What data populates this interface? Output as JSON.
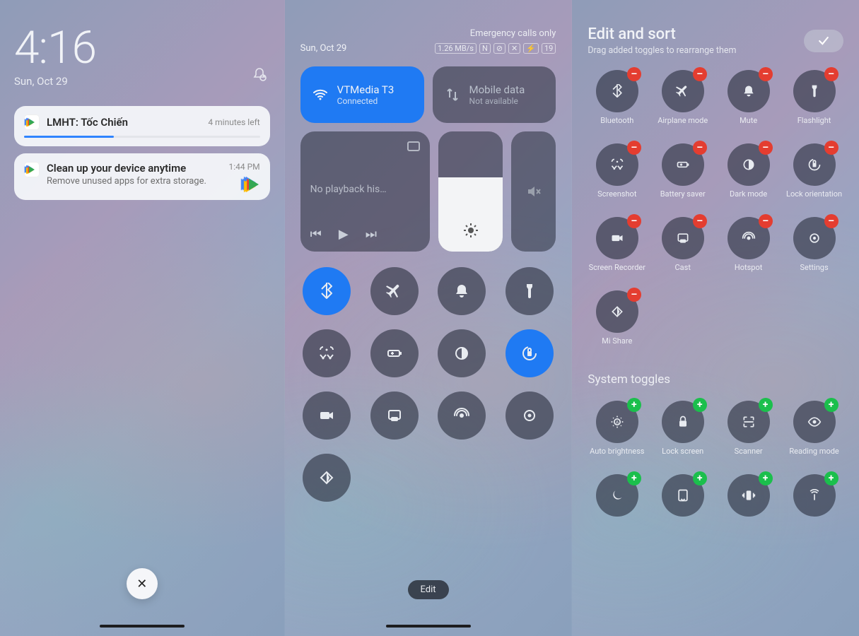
{
  "p1": {
    "time": "4:16",
    "date": "Sun, Oct 29",
    "notif1": {
      "title": "LMHT: Tốc Chiến",
      "meta": "4 minutes left"
    },
    "notif2": {
      "title": "Clean up your device anytime",
      "sub": "Remove unused apps for extra storage.",
      "meta": "1:44 PM"
    }
  },
  "p2": {
    "date": "Sun, Oct 29",
    "status": {
      "line1": "Emergency calls only",
      "speed": "1.26 MB/s",
      "battery": "19"
    },
    "wifi": {
      "name": "VTMedia T3",
      "sub": "Connected"
    },
    "mobile": {
      "name": "Mobile data",
      "sub": "Not available"
    },
    "media": {
      "title": "No playback his…"
    },
    "toggles": [
      {
        "name": "bluetooth",
        "on": true
      },
      {
        "name": "airplane",
        "on": false
      },
      {
        "name": "mute-bell",
        "on": false
      },
      {
        "name": "flashlight",
        "on": false
      },
      {
        "name": "screenshot",
        "on": false
      },
      {
        "name": "battery-saver",
        "on": false
      },
      {
        "name": "dark-mode",
        "on": false
      },
      {
        "name": "lock-orientation",
        "on": true
      },
      {
        "name": "screen-recorder",
        "on": false
      },
      {
        "name": "cast",
        "on": false
      },
      {
        "name": "hotspot",
        "on": false
      },
      {
        "name": "settings",
        "on": false
      },
      {
        "name": "mi-share",
        "on": false
      }
    ],
    "edit": "Edit"
  },
  "p3": {
    "title": "Edit and sort",
    "sub": "Drag added toggles to rearrange them",
    "added": [
      {
        "name": "bluetooth",
        "label": "Bluetooth"
      },
      {
        "name": "airplane",
        "label": "Airplane mode"
      },
      {
        "name": "mute-bell",
        "label": "Mute"
      },
      {
        "name": "flashlight",
        "label": "Flashlight"
      },
      {
        "name": "screenshot",
        "label": "Screenshot"
      },
      {
        "name": "battery-saver",
        "label": "Battery saver"
      },
      {
        "name": "dark-mode",
        "label": "Dark mode"
      },
      {
        "name": "lock-orientation",
        "label": "Lock orientation"
      },
      {
        "name": "screen-recorder",
        "label": "Screen Recorder"
      },
      {
        "name": "cast",
        "label": "Cast"
      },
      {
        "name": "hotspot",
        "label": "Hotspot"
      },
      {
        "name": "settings",
        "label": "Settings"
      },
      {
        "name": "mi-share",
        "label": "Mi Share"
      }
    ],
    "system_title": "System toggles",
    "system": [
      {
        "name": "auto-brightness",
        "label": "Auto brightness"
      },
      {
        "name": "lock-screen",
        "label": "Lock screen"
      },
      {
        "name": "scanner",
        "label": "Scanner"
      },
      {
        "name": "reading-mode",
        "label": "Reading mode"
      },
      {
        "name": "dnd",
        "label": ""
      },
      {
        "name": "rotate",
        "label": ""
      },
      {
        "name": "vibrate",
        "label": ""
      },
      {
        "name": "wireless",
        "label": ""
      }
    ]
  }
}
